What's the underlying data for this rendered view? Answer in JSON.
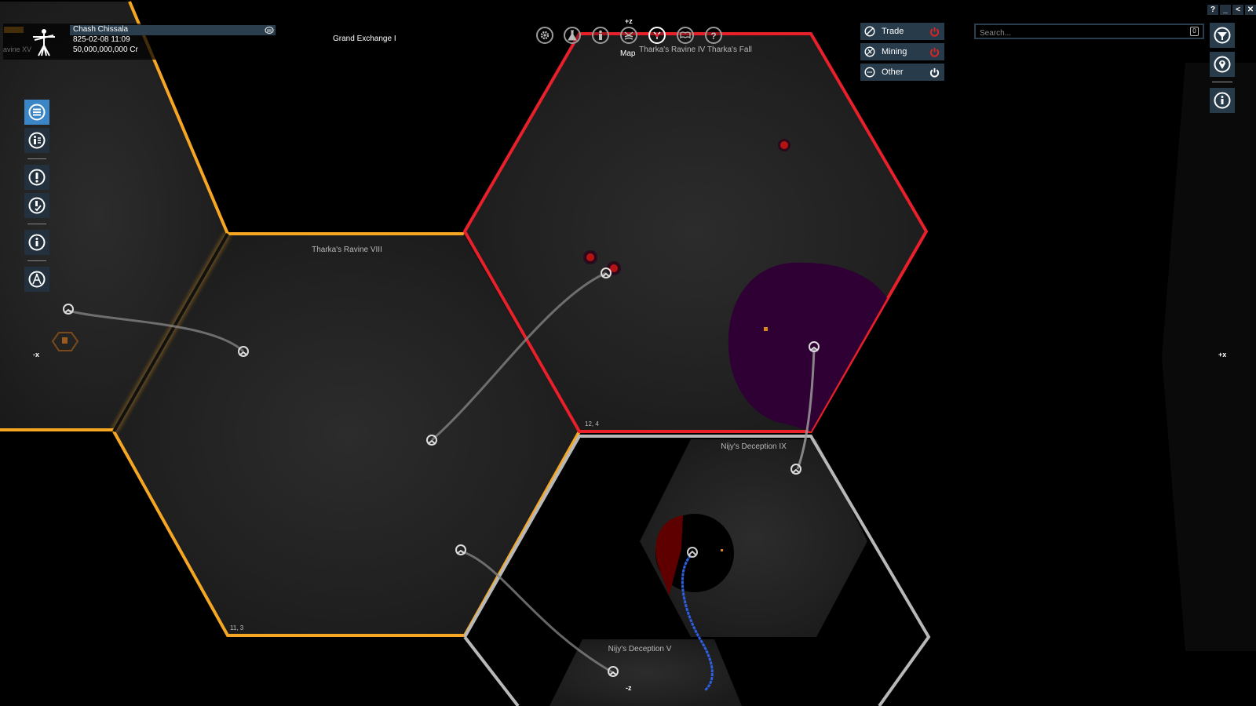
{
  "window": {
    "controls": [
      {
        "name": "help-button",
        "glyph": "?"
      },
      {
        "name": "minimize-button",
        "glyph": "_"
      },
      {
        "name": "back-button",
        "glyph": "<"
      },
      {
        "name": "close-button",
        "glyph": "✕"
      }
    ]
  },
  "player": {
    "name": "Chash Chissala",
    "datetime": "825-02-08 11:09",
    "credits": "50,000,000,000 Cr",
    "location": "Grand Exchange I",
    "ghost_sector": "avine XV"
  },
  "toolbar": {
    "plus_z": "+z",
    "active_label": "Map",
    "items": [
      {
        "name": "settings",
        "icon": "gear-icon"
      },
      {
        "name": "research",
        "icon": "flask-icon"
      },
      {
        "name": "player-info",
        "icon": "person-icon"
      },
      {
        "name": "empire",
        "icon": "empire-icon"
      },
      {
        "name": "map",
        "icon": "map-icon",
        "active": true
      },
      {
        "name": "encyclopedia",
        "icon": "book-icon"
      },
      {
        "name": "help",
        "icon": "question-icon"
      }
    ]
  },
  "filters": [
    {
      "label": "Trade",
      "icon": "trade-icon",
      "state": "off",
      "color": "#e02424"
    },
    {
      "label": "Mining",
      "icon": "mining-icon",
      "state": "off",
      "color": "#e02424"
    },
    {
      "label": "Other",
      "icon": "other-icon",
      "state": "on",
      "color": "#ffffff"
    }
  ],
  "search": {
    "placeholder": "Search...",
    "value": "",
    "count": "0"
  },
  "right_sidebar": [
    {
      "name": "filter",
      "icon": "filter-funnel-icon"
    },
    {
      "name": "location",
      "icon": "map-pin-icon"
    },
    {
      "name": "info",
      "icon": "info-icon"
    }
  ],
  "left_sidebar": [
    {
      "name": "object-list",
      "icon": "list-icon",
      "active": true
    },
    {
      "name": "property-owned",
      "icon": "property-icon",
      "active": false
    },
    {
      "name": "alerts",
      "icon": "alert-icon",
      "active": false
    },
    {
      "name": "mission-alerts",
      "icon": "alert-check-icon",
      "active": false
    },
    {
      "name": "information",
      "icon": "info-icon",
      "active": false
    },
    {
      "name": "plot-course",
      "icon": "compass-icon",
      "active": false
    }
  ],
  "map": {
    "axis_labels": {
      "plus_z": "+z",
      "minus_z": "-z",
      "plus_x": "+x",
      "minus_x": "-x"
    },
    "sectors": [
      {
        "name": "Tharka's Ravine VIII",
        "coords": "11, 3",
        "owner_color": "#f5a623"
      },
      {
        "name": "Tharka's Ravine IV Tharka's Fall",
        "coords": "12, 4",
        "owner_color": "#e8202a"
      },
      {
        "name": "Nijy's Deception IX",
        "coords": "",
        "owner_color": "#b8b8b8"
      },
      {
        "name": "Nijy's Deception V",
        "coords": "",
        "owner_color": "#b8b8b8"
      },
      {
        "name": "Tharka's Ravine XV",
        "coords": "",
        "owner_color": "#f5a623"
      }
    ],
    "colors": {
      "argon": "#f5a623",
      "hostile": "#e8202a",
      "neutral": "#b8b8b8",
      "player_route": "#2f5fe0",
      "hostile_zone": "#2e0033"
    }
  }
}
